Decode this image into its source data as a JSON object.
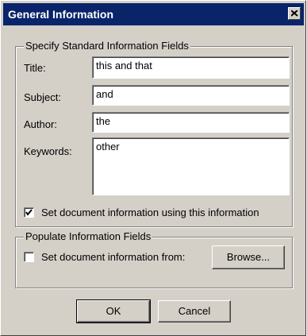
{
  "window": {
    "title": "General Information"
  },
  "standard_group": {
    "legend": "Specify Standard Information Fields",
    "fields": {
      "title": {
        "label": "Title:",
        "value": "this and that"
      },
      "subject": {
        "label": "Subject:",
        "value": "and"
      },
      "author": {
        "label": "Author:",
        "value": "the"
      },
      "keywords": {
        "label": "Keywords:",
        "value": "other"
      }
    },
    "use_info_checkbox": {
      "label": "Set document information using this information",
      "checked": true
    }
  },
  "populate_group": {
    "legend": "Populate Information Fields",
    "from_checkbox": {
      "label": "Set document information from:",
      "checked": false
    },
    "browse_label": "Browse..."
  },
  "buttons": {
    "ok": "OK",
    "cancel": "Cancel"
  }
}
